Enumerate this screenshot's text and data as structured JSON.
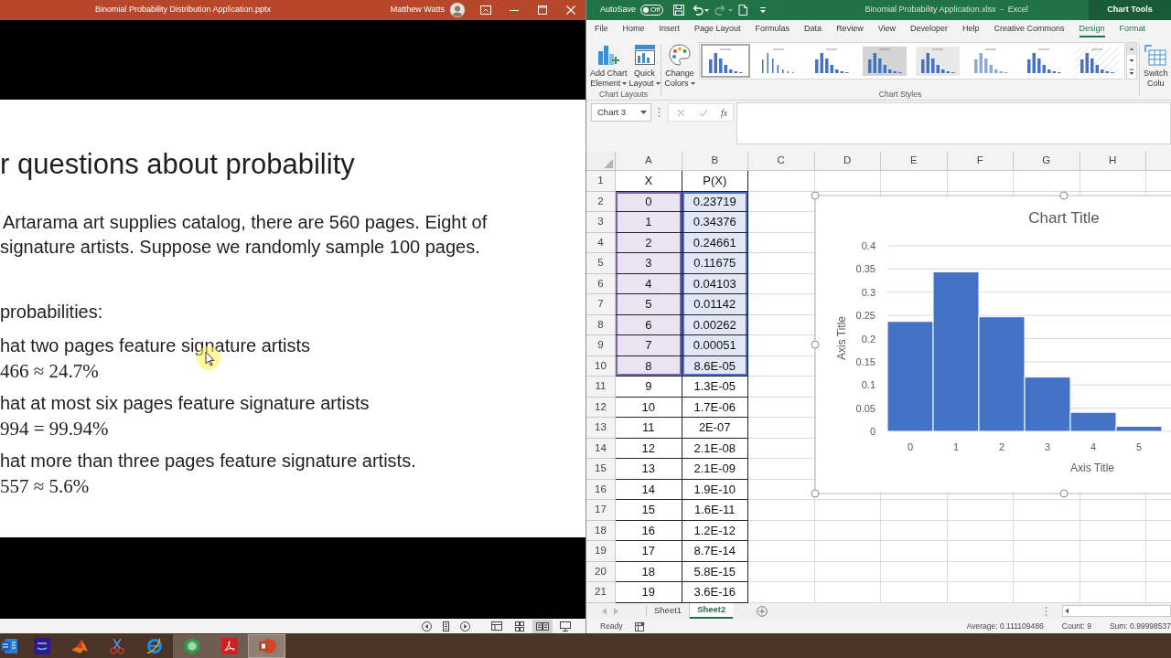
{
  "powerpoint": {
    "window": {
      "title": "Binomial Probability Distribution Application.pptx",
      "user": "Matthew Watts"
    },
    "slide": {
      "title": "r questions about probability",
      "intro_lines": [
        "Artarama art supplies catalog, there are 560 pages. Eight of",
        "signature artists. Suppose we randomly sample 100 pages."
      ],
      "prompt": "probabilities:",
      "questions": [
        {
          "text": "hat two pages feature signature artists",
          "answer": "466 ≈ 24.7%"
        },
        {
          "text": "hat at most six pages feature signature artists",
          "answer": "994 = 99.94%"
        },
        {
          "text": "hat more than three pages feature signature artists.",
          "answer": "557 ≈ 5.6%"
        }
      ]
    },
    "status_bar": {
      "views": [
        {
          "kind": "normal",
          "selected": false
        },
        {
          "kind": "slide_sorter",
          "selected": false
        },
        {
          "kind": "reading",
          "selected": true
        },
        {
          "kind": "slide_show",
          "selected": false
        }
      ]
    }
  },
  "excel": {
    "window": {
      "title": "Binomial Probability Application.xlsx  -  Excel",
      "context": "Chart Tools"
    },
    "quick_access": {
      "autosave_label": "AutoSave",
      "autosave": {
        "on": false,
        "label": "Off"
      }
    },
    "tabs": [
      {
        "label": "File",
        "selected": false,
        "contextual": false
      },
      {
        "label": "Home",
        "selected": false,
        "contextual": false
      },
      {
        "label": "Insert",
        "selected": false,
        "contextual": false
      },
      {
        "label": "Page Layout",
        "selected": false,
        "contextual": false
      },
      {
        "label": "Formulas",
        "selected": false,
        "contextual": false
      },
      {
        "label": "Data",
        "selected": false,
        "contextual": false
      },
      {
        "label": "Review",
        "selected": false,
        "contextual": false
      },
      {
        "label": "View",
        "selected": false,
        "contextual": false
      },
      {
        "label": "Developer",
        "selected": false,
        "contextual": false
      },
      {
        "label": "Help",
        "selected": false,
        "contextual": false
      },
      {
        "label": "Creative Commons",
        "selected": false,
        "contextual": false
      },
      {
        "label": "Design",
        "selected": true,
        "contextual": true
      },
      {
        "label": "Format",
        "selected": false,
        "contextual": true
      }
    ],
    "ribbon": {
      "layouts": {
        "label": "Chart Layouts",
        "buttons": [
          {
            "kind": "add_chart_element",
            "lines": [
              "Add Chart",
              "Element"
            ],
            "dropdown": true
          },
          {
            "kind": "quick_layout",
            "lines": [
              "Quick",
              "Layout"
            ],
            "dropdown": true
          }
        ]
      },
      "styles": {
        "label": "Chart Styles",
        "buttons": [
          {
            "kind": "change_colors",
            "lines": [
              "Change",
              "Colors"
            ],
            "dropdown": true
          }
        ],
        "gallery": [
          {
            "kind": "plain",
            "selected": true
          },
          {
            "kind": "plain",
            "selected": false
          },
          {
            "kind": "plain",
            "selected": false
          },
          {
            "kind": "shaded",
            "selected": false
          },
          {
            "kind": "shaded",
            "selected": false
          },
          {
            "kind": "plain",
            "selected": false
          },
          {
            "kind": "plain",
            "selected": false
          },
          {
            "kind": "hatched",
            "selected": false
          }
        ]
      },
      "data": {
        "buttons": [
          {
            "kind": "switch_row_column",
            "lines": [
              "Switch",
              "Colu"
            ],
            "dropdown": false
          }
        ]
      }
    },
    "formula_bar": {
      "name_box": "Chart 3",
      "function_label": "fx"
    },
    "sheet": {
      "columns": [
        "A",
        "B",
        "C",
        "D",
        "E",
        "F",
        "G",
        "H"
      ],
      "rows": [
        {
          "number": "1",
          "cells": [
            "X",
            "P(X)"
          ],
          "selected": false
        },
        {
          "number": "2",
          "cells": [
            "0",
            "0.23719"
          ],
          "selected": true
        },
        {
          "number": "3",
          "cells": [
            "1",
            "0.34376"
          ],
          "selected": true
        },
        {
          "number": "4",
          "cells": [
            "2",
            "0.24661"
          ],
          "selected": true
        },
        {
          "number": "5",
          "cells": [
            "3",
            "0.11675"
          ],
          "selected": true
        },
        {
          "number": "6",
          "cells": [
            "4",
            "0.04103"
          ],
          "selected": true
        },
        {
          "number": "7",
          "cells": [
            "5",
            "0.01142"
          ],
          "selected": true
        },
        {
          "number": "8",
          "cells": [
            "6",
            "0.00262"
          ],
          "selected": true
        },
        {
          "number": "9",
          "cells": [
            "7",
            "0.00051"
          ],
          "selected": true
        },
        {
          "number": "10",
          "cells": [
            "8",
            "8.6E-05"
          ],
          "selected": true
        },
        {
          "number": "11",
          "cells": [
            "9",
            "1.3E-05"
          ],
          "selected": false
        },
        {
          "number": "12",
          "cells": [
            "10",
            "1.7E-06"
          ],
          "selected": false
        },
        {
          "number": "13",
          "cells": [
            "11",
            "2E-07"
          ],
          "selected": false
        },
        {
          "number": "14",
          "cells": [
            "12",
            "2.1E-08"
          ],
          "selected": false
        },
        {
          "number": "15",
          "cells": [
            "13",
            "2.1E-09"
          ],
          "selected": false
        },
        {
          "number": "16",
          "cells": [
            "14",
            "1.9E-10"
          ],
          "selected": false
        },
        {
          "number": "17",
          "cells": [
            "15",
            "1.6E-11"
          ],
          "selected": false
        },
        {
          "number": "18",
          "cells": [
            "16",
            "1.2E-12"
          ],
          "selected": false
        },
        {
          "number": "19",
          "cells": [
            "17",
            "8.7E-14"
          ],
          "selected": false
        },
        {
          "number": "20",
          "cells": [
            "18",
            "5.8E-15"
          ],
          "selected": false
        },
        {
          "number": "21",
          "cells": [
            "19",
            "3.6E-16"
          ],
          "selected": false
        }
      ]
    },
    "chart": {
      "chart_data": {
        "type": "bar",
        "title": "Chart Title",
        "xlabel": "Axis Title",
        "ylabel": "Axis Title",
        "categories": [
          "0",
          "1",
          "2",
          "3",
          "4",
          "5"
        ],
        "series": [
          {
            "color": "#4472c4",
            "values": [
              0.237,
              0.344,
              0.247,
              0.117,
              0.041,
              0.011
            ]
          }
        ],
        "ylim": [
          0,
          0.4
        ],
        "yticks": [
          0,
          0.05,
          0.1,
          0.15,
          0.2,
          0.25,
          0.3,
          0.35,
          0.4
        ],
        "grid": true
      }
    },
    "sheet_tabs": [
      {
        "label": "Sheet1",
        "selected": false
      },
      {
        "label": "Sheet2",
        "selected": true
      }
    ],
    "status_bar": {
      "mode": "Ready",
      "stats": [
        "Average: 0.111109486",
        "Count: 9",
        "Sum: 0.99998537"
      ]
    }
  },
  "taskbar": {
    "apps": [
      {
        "kind": "word",
        "open": false,
        "active": false
      },
      {
        "kind": "music",
        "open": false,
        "active": false
      },
      {
        "kind": "peak",
        "open": false,
        "active": false
      },
      {
        "kind": "scissors",
        "open": false,
        "active": false
      },
      {
        "kind": "browser",
        "open": false,
        "active": false
      },
      {
        "kind": "hexagon",
        "open": true,
        "active": false
      },
      {
        "kind": "pdf",
        "open": true,
        "active": false
      },
      {
        "kind": "presentation",
        "open": true,
        "active": true
      }
    ]
  }
}
